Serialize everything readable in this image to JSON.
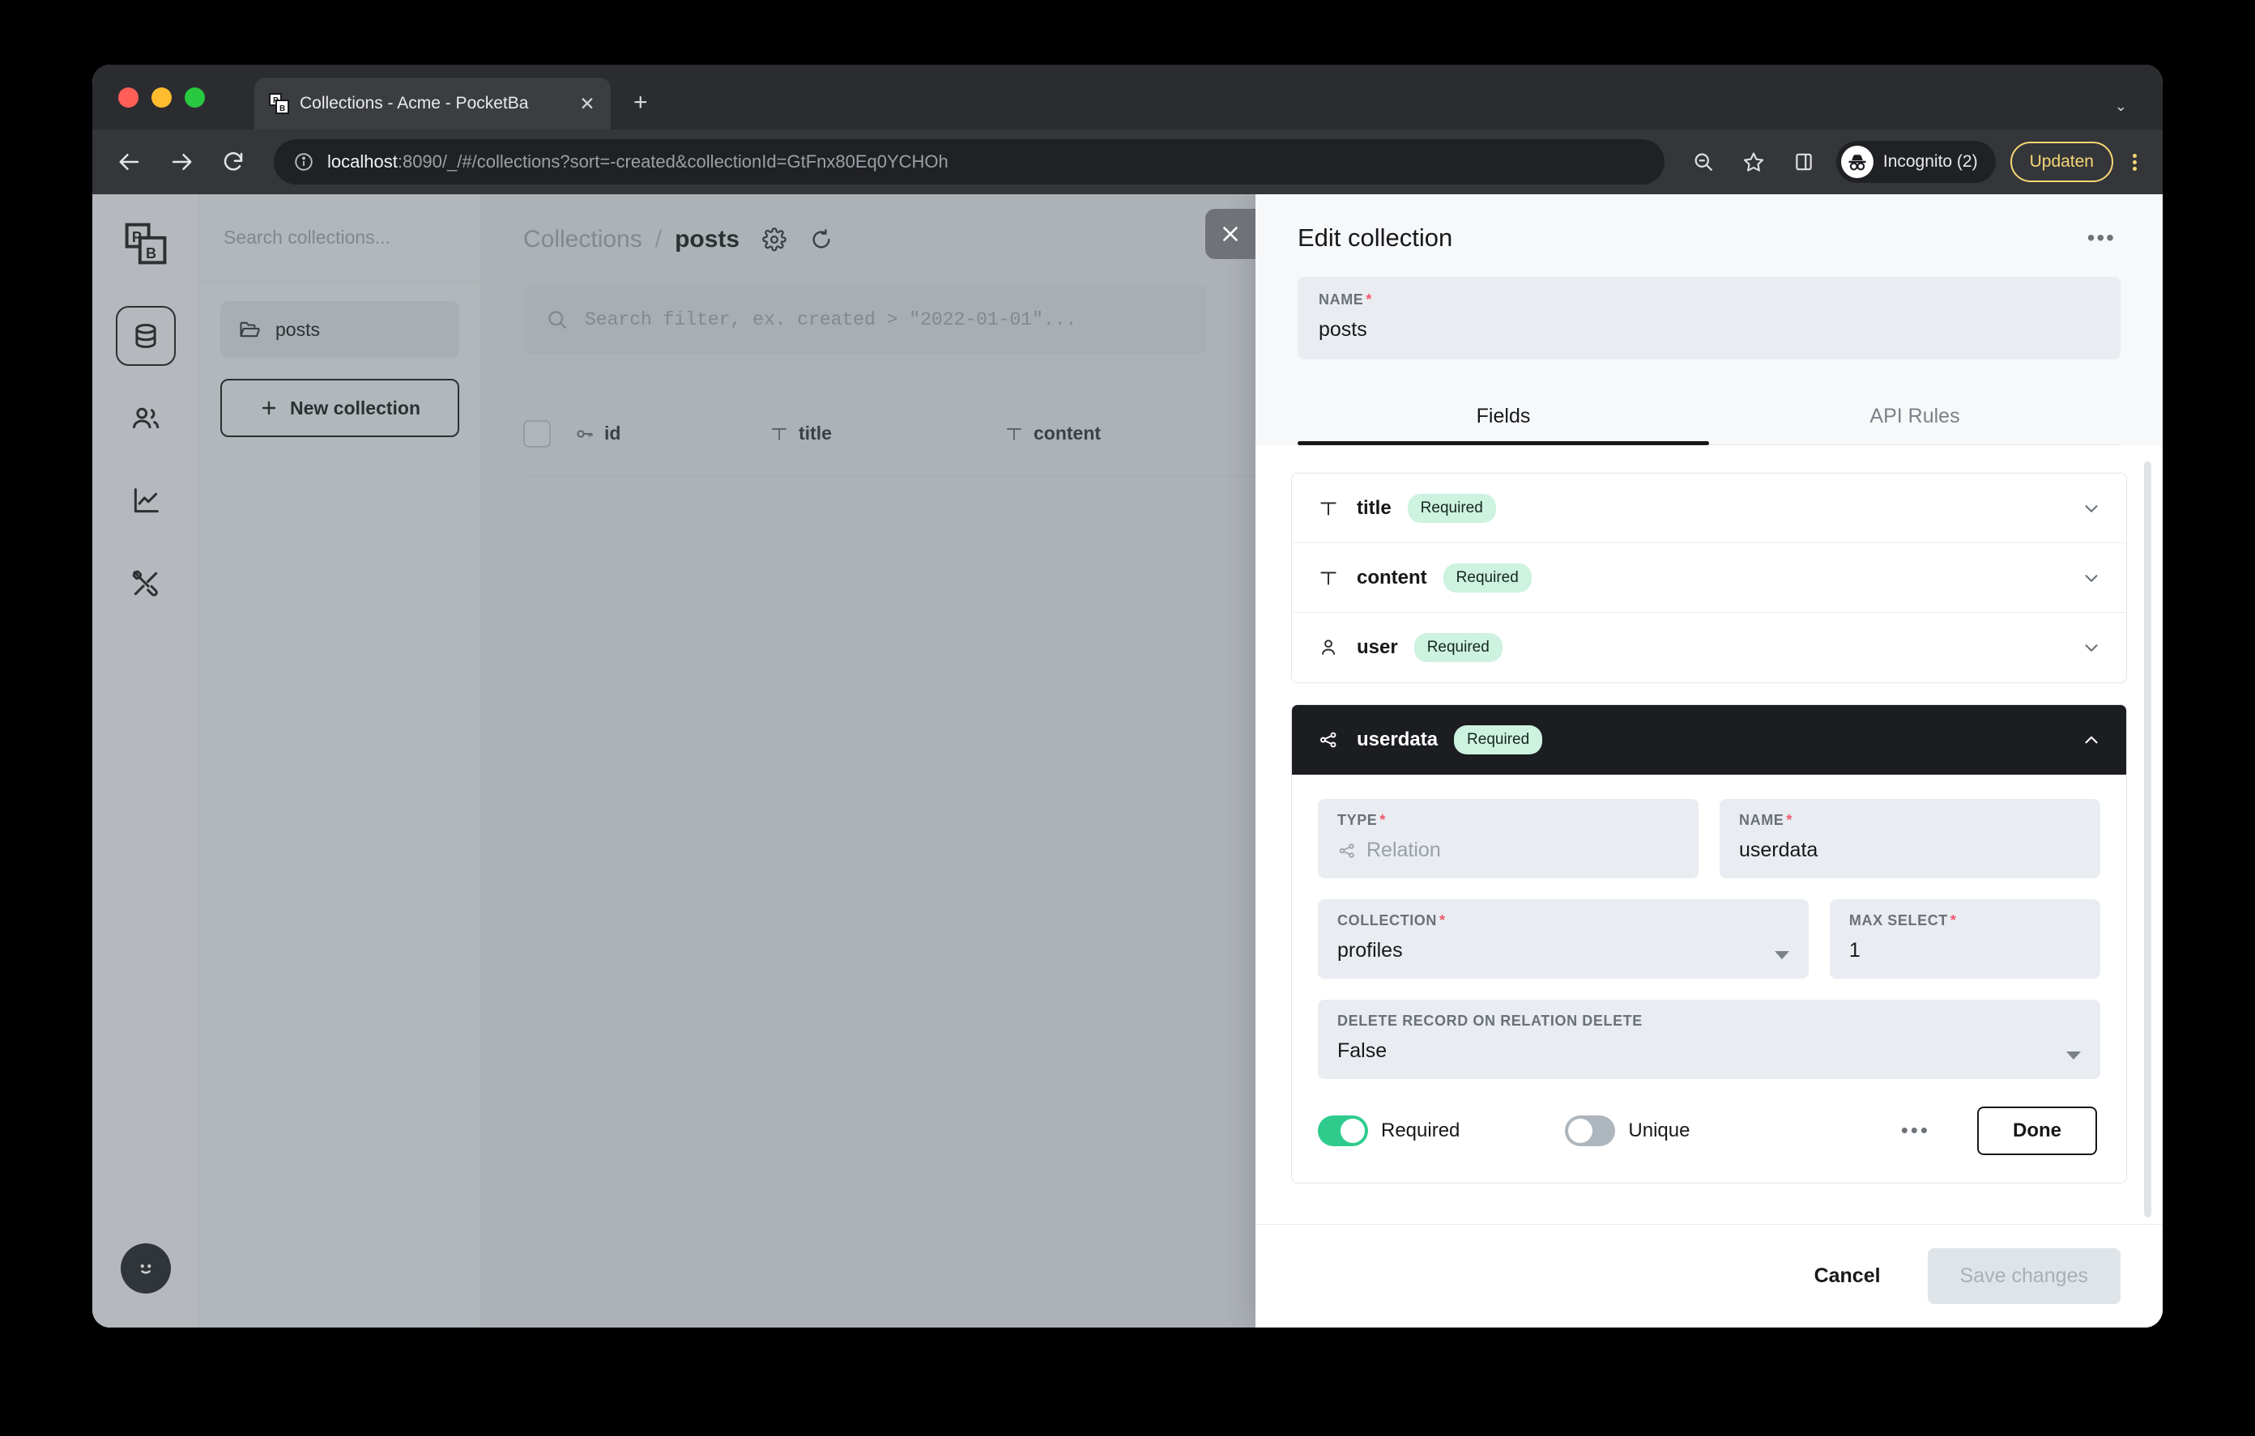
{
  "browser": {
    "tab": {
      "title": "Collections - Acme - PocketBa",
      "favicon_icon": "pocketbase-favicon",
      "close_icon": "close-icon"
    },
    "new_tab_icon": "plus-icon",
    "tab_list_icon": "chevron-down-icon",
    "back_icon": "back-arrow-icon",
    "forward_icon": "forward-arrow-icon",
    "reload_icon": "reload-icon",
    "site_info_icon": "info-circle-icon",
    "url_host": "localhost",
    "url_rest": ":8090/_/#/collections?sort=-created&collectionId=GtFnx80Eq0YCHOh",
    "zoom_out_icon": "zoom-out-icon",
    "bookmark_icon": "star-icon",
    "side_panel_icon": "side-panel-icon",
    "incognito_icon": "incognito-avatar-icon",
    "incognito_label": "Incognito (2)",
    "update_label": "Updaten",
    "menu_icon": "kebab-menu-icon"
  },
  "app": {
    "rail": {
      "logo_icon": "pocketbase-logo",
      "items": [
        {
          "icon": "database-icon",
          "name": "collections",
          "active": true
        },
        {
          "icon": "users-icon",
          "name": "users",
          "active": false
        },
        {
          "icon": "logs-chart-icon",
          "name": "logs",
          "active": false
        },
        {
          "icon": "settings-tools-icon",
          "name": "settings",
          "active": false
        }
      ],
      "avatar_icon": "smiley-avatar-icon"
    },
    "collections": {
      "search_placeholder": "Search collections...",
      "items": [
        {
          "label": "posts",
          "icon": "folder-icon",
          "selected": true
        }
      ],
      "new_collection_label": "New collection",
      "new_collection_icon": "plus-icon"
    },
    "records": {
      "breadcrumb_root": "Collections",
      "breadcrumb_sep": "/",
      "breadcrumb_current": "posts",
      "settings_icon": "gear-icon",
      "refresh_icon": "refresh-icon",
      "filter_placeholder": "Search filter, ex. created > \"2022-01-01\"...",
      "filter_icon": "search-icon",
      "columns": [
        {
          "label": "id",
          "icon": "key-icon"
        },
        {
          "label": "title",
          "icon": "text-type-icon"
        },
        {
          "label": "content",
          "icon": "text-type-icon"
        }
      ]
    }
  },
  "drawer": {
    "close_icon": "close-icon",
    "title": "Edit collection",
    "menu_icon": "ellipsis-icon",
    "name_field": {
      "label": "NAME",
      "required_mark": "*",
      "value": "posts"
    },
    "tabs": [
      {
        "label": "Fields",
        "active": true
      },
      {
        "label": "API Rules",
        "active": false
      }
    ],
    "fields": [
      {
        "name": "title",
        "icon": "text-type-icon",
        "badge": "Required",
        "chevron": "chevron-down-icon"
      },
      {
        "name": "content",
        "icon": "text-type-icon",
        "badge": "Required",
        "chevron": "chevron-down-icon"
      },
      {
        "name": "user",
        "icon": "user-icon",
        "badge": "Required",
        "chevron": "chevron-down-icon"
      }
    ],
    "expanded_field": {
      "name": "userdata",
      "icon": "relation-icon",
      "badge": "Required",
      "chevron": "chevron-up-icon",
      "type": {
        "label": "TYPE",
        "required_mark": "*",
        "value": "Relation",
        "icon": "relation-icon",
        "disabled": true
      },
      "field_name": {
        "label": "NAME",
        "required_mark": "*",
        "value": "userdata"
      },
      "collection": {
        "label": "COLLECTION",
        "required_mark": "*",
        "value": "profiles"
      },
      "max_select": {
        "label": "MAX SELECT",
        "required_mark": "*",
        "value": "1"
      },
      "cascade_delete": {
        "label": "DELETE RECORD ON RELATION DELETE",
        "value": "False"
      },
      "required_toggle": {
        "label": "Required",
        "on": true
      },
      "unique_toggle": {
        "label": "Unique",
        "on": false
      },
      "more_icon": "ellipsis-icon",
      "done_label": "Done"
    },
    "footer": {
      "cancel_label": "Cancel",
      "save_label": "Save changes",
      "save_disabled": true
    }
  },
  "colors": {
    "accent_green": "#2ecb8d",
    "badge_bg": "#cdf2e0",
    "required_star": "#f05a6e",
    "dark": "#1b1d21",
    "update_yellow": "#f7d774"
  }
}
